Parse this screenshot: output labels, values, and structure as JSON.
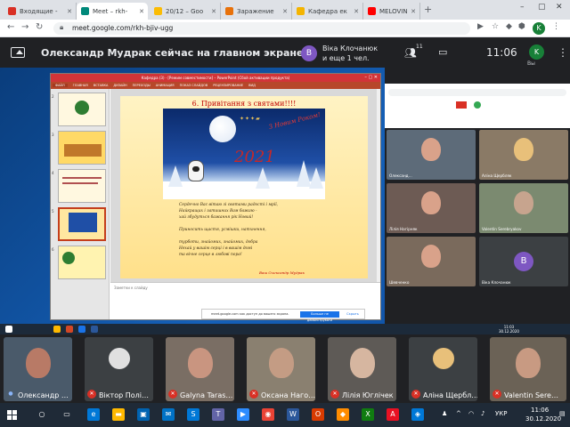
{
  "browser": {
    "tabs": [
      {
        "label": "Входящие - ",
        "color": "#d93025",
        "active": false
      },
      {
        "label": "Meet – rkh-",
        "color": "#00897b",
        "active": true
      },
      {
        "label": "20/12 – Goo",
        "color": "#fbbc04",
        "active": false
      },
      {
        "label": "Заражение",
        "color": "#e8710a",
        "active": false
      },
      {
        "label": "Кафедра ек",
        "color": "#f4b400",
        "active": false
      },
      {
        "label": "MELOVIN - ",
        "color": "#ff0000",
        "active": false
      }
    ],
    "new_tab": "+",
    "url": "meet.google.com/rkh-bjiv-ugg",
    "profile_initial": "K"
  },
  "meet": {
    "presentation_title": "Олександр Мудрак сейчас на главном экране",
    "presenter_initial": "B",
    "presenter_line1": "Віка Клочанюк",
    "presenter_line2": "и еще 1 чел.",
    "people_count": "11",
    "time": "11:06",
    "self_initial": "K",
    "self_label": "Вы"
  },
  "powerpoint": {
    "window_title": "Кафедра (3) · [Режим совместимости] – PowerPoint (Сбой активации продукта)",
    "ribbon_tabs": [
      "ФАЙЛ",
      "ГЛАВНАЯ",
      "ВСТАВКА",
      "ДИЗАЙН",
      "ПЕРЕХОДЫ",
      "АНИМАЦИЯ",
      "ПОКАЗ СЛАЙДОВ",
      "РЕЦЕНЗИРОВАНИЕ",
      "ВИД"
    ],
    "thumb_numbers": [
      "2",
      "3",
      "4",
      "5",
      "6"
    ],
    "notes_placeholder": "Заметки к слайду",
    "slide": {
      "title": "6. Привітання з святами!!!!",
      "card_greeting": "З Новим Роком!",
      "card_year": "2021",
      "poem": [
        "Сердечно Вас вітаю зі святами радості і мрії,",
        "Найкращих і затишних Вам бажаю -",
        "хай збудуться бажання рік Новий!",
        "",
        "Приносить щастя, усмішки, натхнення,",
        "",
        "турботи, знайомих, знайомих, добра",
        "Нехай у вашім серці і в вашім домі",
        "та вічне серце в любові пора!"
      ],
      "signature": "Ваш Олександр Мудрак"
    }
  },
  "share_bar": {
    "text": "meet.google.com как доступ до вашего экрана.",
    "stop_label": "Больше не демонструвати",
    "hide_label": "Скрыть"
  },
  "inner_meet": {
    "participants": [
      {
        "name": "Олександ…"
      },
      {
        "name": "Аліна Щербляк"
      },
      {
        "name": "Лілія Нагірняк"
      },
      {
        "name": "Valentin Serebryakov"
      },
      {
        "name": "Шевченко"
      },
      {
        "name": "Віка Клочанюк"
      }
    ],
    "avatar_initial": "B",
    "clock_time": "11:03",
    "clock_date": "30.12.2020"
  },
  "participants": [
    {
      "name": "Олександр …",
      "mic_on": true
    },
    {
      "name": "Віктор Полі…",
      "mic_on": false
    },
    {
      "name": "Galyna Taras…",
      "mic_on": false
    },
    {
      "name": "Оксана Наго…",
      "mic_on": false
    },
    {
      "name": "Лілія Юглічек",
      "mic_on": false
    },
    {
      "name": "Аліна Щербл…",
      "mic_on": false
    },
    {
      "name": "Valentin Sere…",
      "mic_on": false
    }
  ],
  "taskbar": {
    "language": "УКР",
    "time": "11:06",
    "date": "30.12.2020"
  }
}
